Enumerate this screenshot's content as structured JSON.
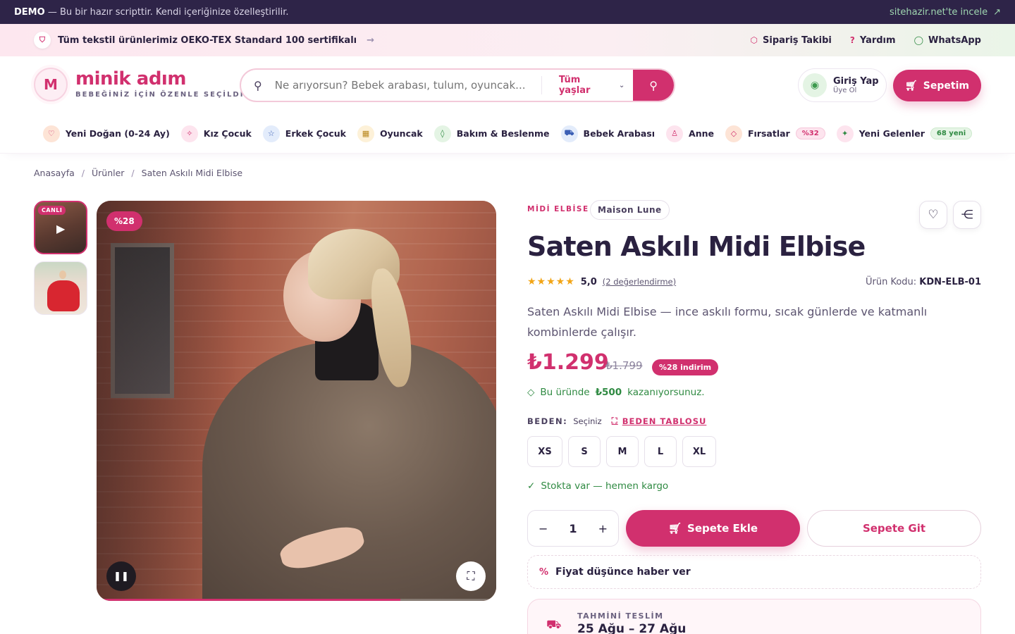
{
  "demo_bar": {
    "tag": "DEMO",
    "text": "— Bu bir hazır scripttir. Kendi içeriğinize özelleştirilir.",
    "link": "sitehazir.net'te incele"
  },
  "announcement": {
    "text": "Tüm tekstil ürünlerimiz OEKO-TEX Standard 100 sertifikalı",
    "links": [
      "Sipariş Takibi",
      "Yardım",
      "WhatsApp"
    ]
  },
  "header": {
    "logo_letter": "M",
    "logo_name": "minik adım",
    "logo_tagline": "BEBEĞİNİZ İÇİN ÖZENLE SEÇİLDİ",
    "search_placeholder": "Ne arıyorsun? Bebek arabası, tulum, oyuncak...",
    "age_filter": "Tüm yaşlar",
    "login_title": "Giriş Yap",
    "login_sub": "Üye Ol",
    "cart_label": "Sepetim"
  },
  "categories": [
    {
      "label": "Yeni Doğan (0-24 Ay)",
      "icon": "heart-icon",
      "color": "#fde4d6"
    },
    {
      "label": "Kız Çocuk",
      "icon": "sparkle-icon",
      "color": "#fde4ee"
    },
    {
      "label": "Erkek Çocuk",
      "icon": "star-icon",
      "color": "#e3ecfb"
    },
    {
      "label": "Oyuncak",
      "icon": "blocks-icon",
      "color": "#fdf1d8"
    },
    {
      "label": "Bakım & Beslenme",
      "icon": "drop-icon",
      "color": "#e4f4e4"
    },
    {
      "label": "Bebek Arabası",
      "icon": "stroller-icon",
      "color": "#e3ecfb"
    },
    {
      "label": "Anne",
      "icon": "user-icon",
      "color": "#fde4ee"
    },
    {
      "label": "Fırsatlar",
      "icon": "tag-icon",
      "color": "#fde4d6",
      "badge": "%32"
    },
    {
      "label": "Yeni Gelenler",
      "icon": "sparkle-icon",
      "color": "#fde4ee",
      "badge": "68 yeni"
    }
  ],
  "breadcrumb": [
    "Anasayfa",
    "Ürünler",
    "Saten Askılı Midi Elbise"
  ],
  "gallery": {
    "live_tag": "CANLI",
    "discount_badge": "%28",
    "video_progress": 0.76
  },
  "product": {
    "category": "MİDİ ELBİSE",
    "brand": "Maison Lune",
    "title": "Saten Askılı Midi Elbise",
    "rating": "5,0",
    "rating_stars": 5,
    "reviews": "(2 değerlendirme)",
    "sku_label": "Ürün Kodu:",
    "sku": "KDN-ELB-01",
    "description": "Saten Askılı Midi Elbise — ince askılı formu, sıcak günlerde ve katmanlı kombinlerde çalışır.",
    "price": "₺1.299",
    "old_price": "₺1.799",
    "discount": "%28 indirim",
    "earn_prefix": "Bu üründe",
    "earn_amount": "₺500",
    "earn_suffix": "kazanıyorsunuz.",
    "size_label": "BEDEN:",
    "size_sub": "Seçiniz",
    "size_guide": "BEDEN TABLOSU",
    "sizes": [
      "XS",
      "S",
      "M",
      "L",
      "XL"
    ],
    "stock": "Stokta var — hemen kargo",
    "quantity": "1",
    "add_to_cart": "Sepete Ekle",
    "go_to_cart": "Sepete Git",
    "price_alert": "Fiyat düşünce haber ver",
    "delivery_label": "TAHMİNİ TESLİM",
    "delivery_dates": "25 Ağu – 27 Ağu"
  },
  "colors": {
    "accent": "#d1306e",
    "success": "#2f8a42",
    "dark": "#2e2448"
  }
}
